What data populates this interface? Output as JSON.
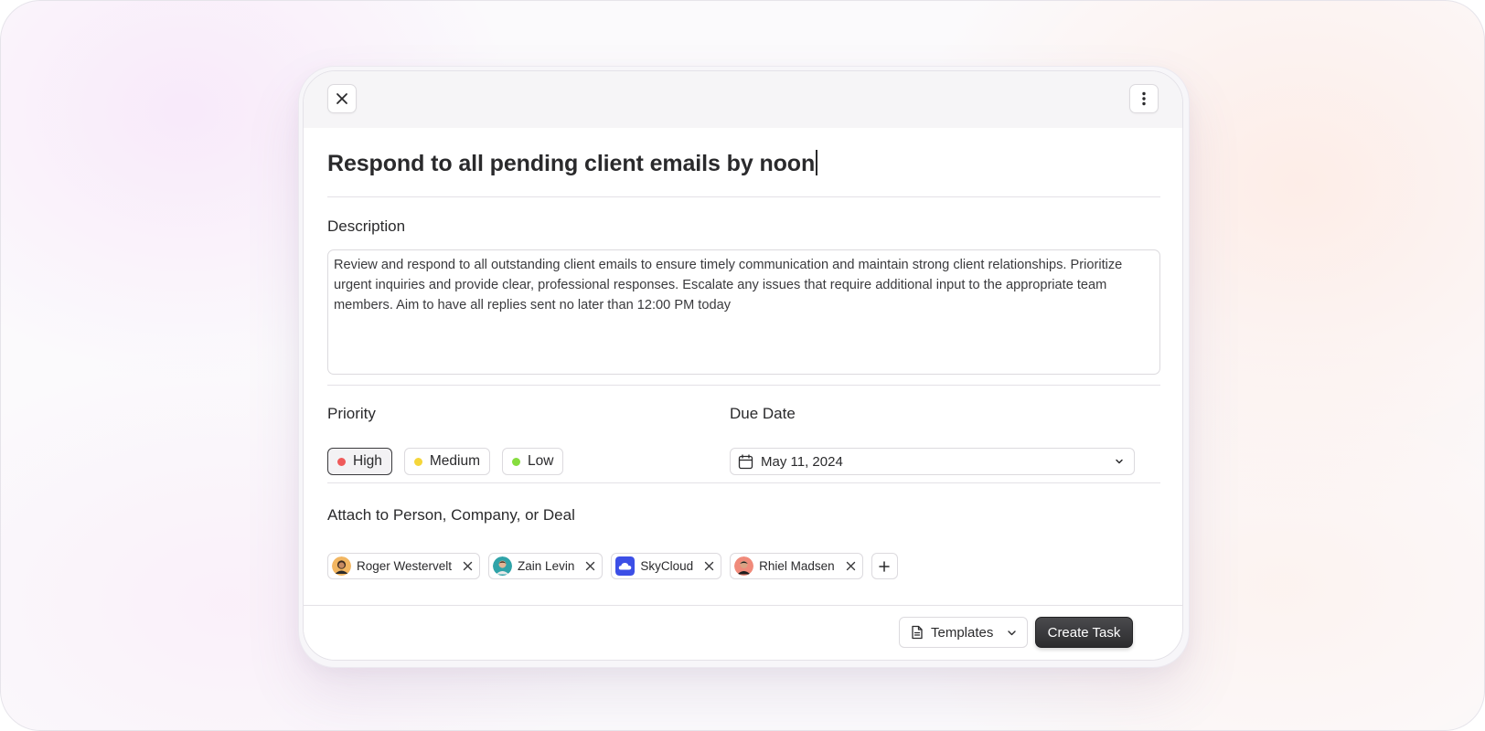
{
  "task": {
    "title": "Respond to all pending client emails by noon",
    "description_label": "Description",
    "description": "Review and respond to all outstanding client emails to ensure timely communication and maintain strong client relationships. Prioritize urgent inquiries and provide clear, professional responses. Escalate any issues that require additional input to the appropriate team members. Aim to have all replies sent no later than 12:00 PM today"
  },
  "priority": {
    "label": "Priority",
    "selected": "High",
    "options": [
      {
        "label": "High",
        "color": "#ef5a5a"
      },
      {
        "label": "Medium",
        "color": "#f5d63a"
      },
      {
        "label": "Low",
        "color": "#86dd3e"
      }
    ]
  },
  "due_date": {
    "label": "Due Date",
    "value": "May 11, 2024"
  },
  "attach": {
    "label": "Attach to Person, Company, or Deal",
    "items": [
      {
        "name": "Roger Westervelt",
        "type": "person"
      },
      {
        "name": "Zain Levin",
        "type": "person"
      },
      {
        "name": "SkyCloud",
        "type": "company"
      },
      {
        "name": "Rhiel Madsen",
        "type": "person"
      }
    ]
  },
  "footer": {
    "templates_label": "Templates",
    "create_label": "Create Task"
  }
}
